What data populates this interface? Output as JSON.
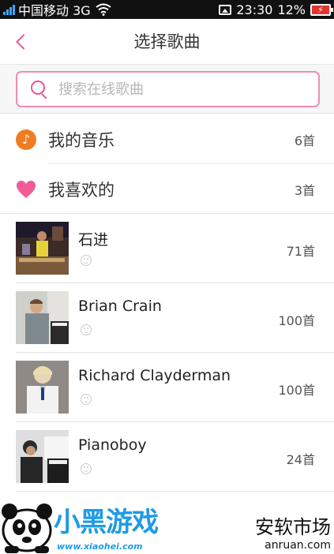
{
  "status_bar": {
    "carrier": "中国移动 3G",
    "time": "23:30",
    "battery": "12%"
  },
  "header": {
    "title": "选择歌曲",
    "back_icon": "chevron-left-icon"
  },
  "search": {
    "placeholder": "搜索在线歌曲"
  },
  "categories": [
    {
      "label": "我的音乐",
      "count": "6首",
      "icon": "music-note-icon"
    },
    {
      "label": "我喜欢的",
      "count": "3首",
      "icon": "heart-icon"
    }
  ],
  "artists": [
    {
      "name": "石进",
      "count": "71首"
    },
    {
      "name": "Brian Crain",
      "count": "100首"
    },
    {
      "name": "Richard Clayderman",
      "count": "100首"
    },
    {
      "name": "Pianoboy",
      "count": "24首"
    }
  ],
  "watermark": {
    "left_logo_text": "小黑游戏",
    "left_url": "www.xiaohei.com",
    "right_title": "安软市场",
    "right_url": "anruan.com"
  },
  "colors": {
    "accent_pink": "#e8578f",
    "music_orange": "#ef7c22",
    "status_bar_bg": "#111111"
  }
}
